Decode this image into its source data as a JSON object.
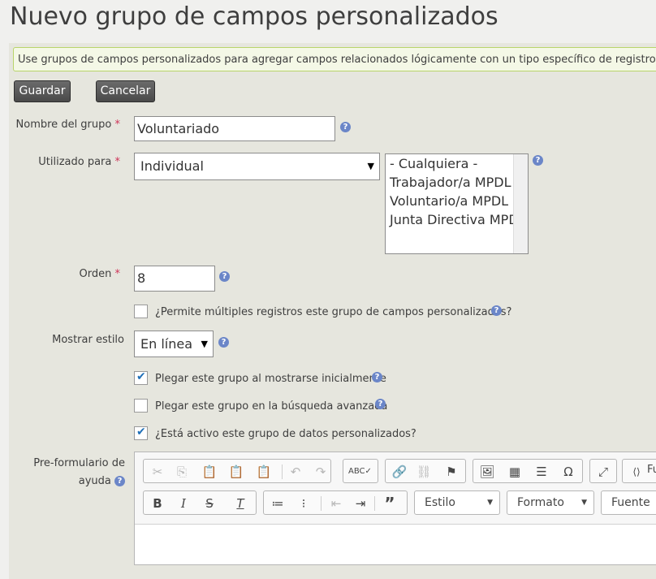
{
  "page": {
    "title": "Nuevo grupo de campos personalizados"
  },
  "help_text": "Use grupos de campos personalizados para agregar campos relacionados lógicamente con un tipo específico de registro.",
  "buttons": {
    "save": "Guardar",
    "cancel": "Cancelar"
  },
  "fields": {
    "group_name": {
      "label": "Nombre del grupo",
      "value": "Voluntariado"
    },
    "used_for": {
      "label": "Utilizado para",
      "value": "Individual",
      "subtypes": [
        "- Cualquiera -",
        "Trabajador/a MPDL",
        "Voluntario/a MPDL",
        "Junta Directiva MPDL"
      ]
    },
    "order": {
      "label": "Orden",
      "value": "8"
    },
    "multiple": {
      "label": "¿Permite múltiples registros este grupo de campos personalizados?",
      "checked": false
    },
    "style": {
      "label": "Mostrar estilo",
      "value": "En línea"
    },
    "collapse_initial": {
      "label": "Plegar este grupo al mostrarse inicialmente",
      "checked": true
    },
    "collapse_advanced": {
      "label": "Plegar este grupo en la búsqueda avanzada",
      "checked": false
    },
    "active": {
      "label": "¿Está activo este grupo de datos personalizados?",
      "checked": true
    },
    "pre_form_help": {
      "label": "Pre-formulario de ayuda"
    }
  },
  "required_mark": "*",
  "help_icon": "?",
  "editor": {
    "combos": {
      "style": "Estilo",
      "format": "Formato",
      "font": "Fuente"
    },
    "source_label": "Fu"
  }
}
